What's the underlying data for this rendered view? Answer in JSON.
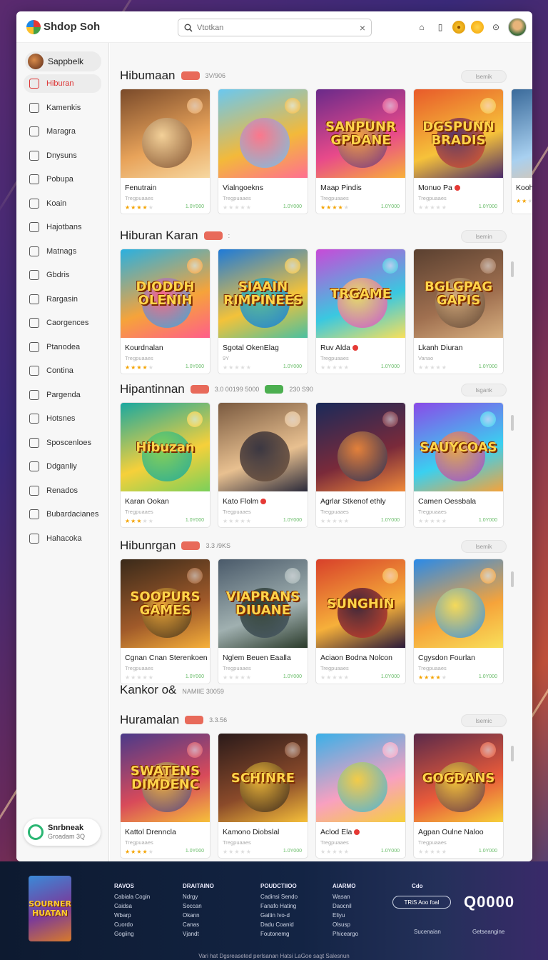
{
  "app": {
    "name": "Shdop Soh"
  },
  "search": {
    "placeholder": "Vtotkan"
  },
  "profile": {
    "name": "Sappbelk"
  },
  "sidebar": {
    "items": [
      {
        "label": "Hiburan"
      },
      {
        "label": "Kamenkis"
      },
      {
        "label": "Maragra"
      },
      {
        "label": "Dnysuns"
      },
      {
        "label": "Pobupa"
      },
      {
        "label": "Koain"
      },
      {
        "label": "Hajotbans"
      },
      {
        "label": "Matnags"
      },
      {
        "label": "Gbdris"
      },
      {
        "label": "Rargasin"
      },
      {
        "label": "Caorgences"
      },
      {
        "label": "Ptanodea"
      },
      {
        "label": "Contina"
      },
      {
        "label": "Pargenda"
      },
      {
        "label": "Hotsnes"
      },
      {
        "label": "Sposcenloes"
      },
      {
        "label": "Ddganliy"
      },
      {
        "label": "Renados"
      },
      {
        "label": "Bubardacianes"
      },
      {
        "label": "Hahacoka"
      }
    ],
    "promo": {
      "title": "Snrbneak",
      "subtitle": "Groadam 3Q"
    }
  },
  "sections": [
    {
      "title": "Hibumaan",
      "pill": "",
      "meta": "3V/906",
      "see_all": "Isemik",
      "cards": [
        {
          "title": "Fenutrain",
          "sub": "Tregpuaaes",
          "stars": 4,
          "price": "1.0Y000",
          "art": "",
          "dot": false
        },
        {
          "title": "Vialngoekns",
          "sub": "Tregpuaaes",
          "stars": 0,
          "price": "1.0Y000",
          "art": "",
          "dot": false
        },
        {
          "title": "Maap Pindis",
          "sub": "Tregpuaaes",
          "stars": 4,
          "price": "1.0Y000",
          "art": "SANPUNR GPDANE",
          "dot": false
        },
        {
          "title": "Monuo Pa",
          "sub": "Tregpuaaes",
          "stars": 0,
          "price": "1.0Y000",
          "art": "DGSPUNN BRADIS",
          "dot": true
        },
        {
          "title": "Kooh L",
          "sub": "",
          "stars": 2,
          "price": "",
          "art": "",
          "dot": false
        }
      ]
    },
    {
      "title": "Hiburan Karan",
      "pill": "",
      "meta": ":",
      "see_all": "Isemin",
      "cards": [
        {
          "title": "Kourdnalan",
          "sub": "Tregpuaaes",
          "stars": 4,
          "price": "1.0Y000",
          "art": "DIODDH OLENIH",
          "dot": false
        },
        {
          "title": "Sgotal OkenElag",
          "sub": "9Y",
          "stars": 0,
          "price": "1.0Y000",
          "art": "SIAAIN RIMPINEES",
          "dot": false
        },
        {
          "title": "Ruv Alda",
          "sub": "Tregpuaaes",
          "stars": 0,
          "price": "1.0Y000",
          "art": "TRGAME",
          "dot": true
        },
        {
          "title": "Lkanh Diuran",
          "sub": "Vanao",
          "stars": 0,
          "price": "1.0Y000",
          "art": "BGLGPAG GAPIS",
          "dot": false
        }
      ]
    },
    {
      "title": "Hipantinnan",
      "pill": "",
      "meta": "3.0 00199 5000",
      "pill2": "",
      "meta2": "230 S90",
      "see_all": "Isgank",
      "cards": [
        {
          "title": "Karan Ookan",
          "sub": "Tregpuaaes",
          "stars": 3,
          "price": "1.0Y000",
          "art": "Hibuzan",
          "dot": false
        },
        {
          "title": "Kato Flolm",
          "sub": "Tregpuaaes",
          "stars": 0,
          "price": "1.0Y000",
          "art": "",
          "dot": true
        },
        {
          "title": "Agrlar Stkenof ethly",
          "sub": "Tregpuaaes",
          "stars": 0,
          "price": "1.0Y000",
          "art": "",
          "dot": false
        },
        {
          "title": "Camen Oessbala",
          "sub": "Tregpuaaes",
          "stars": 0,
          "price": "1.0Y000",
          "art": "SAUYCOAS",
          "dot": false
        }
      ]
    },
    {
      "title": "Hibunrgan",
      "pill": "",
      "meta": "3.3 /9KS",
      "see_all": "Isemik",
      "cards": [
        {
          "title": "Cgnan Cnan Sterenkoen",
          "sub": "Tregpuaaes",
          "stars": 0,
          "price": "1.0Y000",
          "art": "SOOPURS GAMES",
          "dot": false
        },
        {
          "title": "Nglem Beuen Eaalla",
          "sub": "Tregpuaaes",
          "stars": 0,
          "price": "1.0Y000",
          "art": "VIAPRANS DIUANE",
          "dot": false
        },
        {
          "title": "Aciaon Bodna Nolcon",
          "sub": "Tregpuaaes",
          "stars": 0,
          "price": "1.0Y000",
          "art": "SUNGHIN",
          "dot": false
        },
        {
          "title": "Cgysdon Fourlan",
          "sub": "Tregpuaaes",
          "stars": 4,
          "price": "1.0Y000",
          "art": "",
          "dot": false
        }
      ]
    },
    {
      "title": "Huramalan",
      "pill": "",
      "meta": "3.3.56",
      "see_all": "Isemic",
      "pre_title": "Kankor o&",
      "pre_meta": "NAMIIE 30059",
      "cards": [
        {
          "title": "Kattol Drenncla",
          "sub": "Tregpuaaes",
          "stars": 4,
          "price": "1.0Y000",
          "art": "SWATENS DIMDENC",
          "dot": false
        },
        {
          "title": "Kamono Diobslal",
          "sub": "Tregpuaaes",
          "stars": 0,
          "price": "1.0Y000",
          "art": "SCHINRE",
          "dot": false
        },
        {
          "title": "Aclod Ela",
          "sub": "Tregpuaaes",
          "stars": 0,
          "price": "1.0Y000",
          "art": "",
          "dot": true
        },
        {
          "title": "Agpan Oulne Naloo",
          "sub": "Tregpuaaes",
          "stars": 0,
          "price": "1.0Y000",
          "art": "GOGDANS",
          "dot": false
        }
      ]
    }
  ],
  "footer": {
    "art": "SOURNER HUATAN",
    "cols": [
      {
        "h": "RAVOS",
        "items": [
          "Cabiala Cogin",
          "Caidsa",
          "Wbarp",
          "Cuordo",
          "Gogiing"
        ]
      },
      {
        "h": "DRAITAINO",
        "items": [
          "Ndrgy",
          "Soccan",
          "Okann",
          "Canas",
          "Vjandt"
        ]
      },
      {
        "h": "POUDCTIIOO",
        "items": [
          "Cadinsi Sendo",
          "Fanafo Hating",
          "Gaitin Ivo-d",
          "Dadu Coanid",
          "Foutonemg"
        ]
      },
      {
        "h": "AIARMO",
        "items": [
          "Wasan",
          "Daocnil",
          "Eliyu",
          "Olsusp",
          "Phiceargo"
        ]
      },
      {
        "h": "Cdo",
        "items": []
      }
    ],
    "button": "TRiS Aoo foal",
    "big": "Q0000",
    "link1": "Sucenaian",
    "link2": "Getseangine",
    "copyright": "Vari hat Dgsreaseted perlsanan Hatsi LaGoe sagt Salesnun"
  }
}
